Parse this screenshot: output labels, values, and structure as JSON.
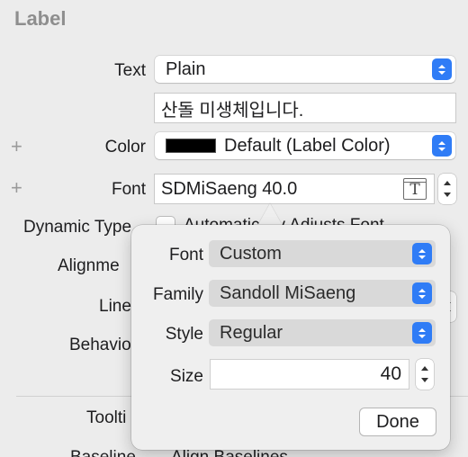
{
  "section": {
    "title": "Label"
  },
  "text_row": {
    "label": "Text",
    "value": "Plain"
  },
  "content_field": {
    "value": "산돌 미생체입니다."
  },
  "color_row": {
    "label": "Color",
    "value": "Default (Label Color)",
    "swatch_color": "#000000"
  },
  "font_row": {
    "label": "Font",
    "value": "SDMiSaeng 40.0",
    "font_icon": "T"
  },
  "dynamic_type_row": {
    "label": "Dynamic Type",
    "checkbox_label": "Automatically Adjusts Font"
  },
  "partial_labels": {
    "alignment": "Alignme",
    "lines": "Line",
    "behavior": "Behavio",
    "tooltip": "Toolti",
    "bottom_left": "Baseline",
    "bottom_right": "Align Baselines"
  },
  "popover": {
    "font_label": "Font",
    "font_value": "Custom",
    "family_label": "Family",
    "family_value": "Sandoll MiSaeng",
    "style_label": "Style",
    "style_value": "Regular",
    "size_label": "Size",
    "size_value": "40",
    "done_label": "Done"
  }
}
